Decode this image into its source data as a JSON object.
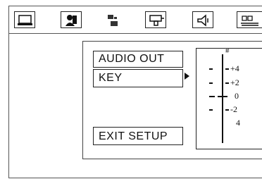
{
  "menu": {
    "audio_out": "AUDIO OUT",
    "key": "KEY",
    "exit_setup": "EXIT SETUP"
  },
  "key_scale": {
    "top_mark": "#",
    "labels": [
      "+4",
      "+2",
      "0",
      "-2",
      "4"
    ]
  },
  "toolbar": {
    "icons": [
      "monitor-icon",
      "speaker-person-icon",
      "small-dolby-icon",
      "projector-icon",
      "speaker-icon",
      "preference-icon"
    ]
  }
}
